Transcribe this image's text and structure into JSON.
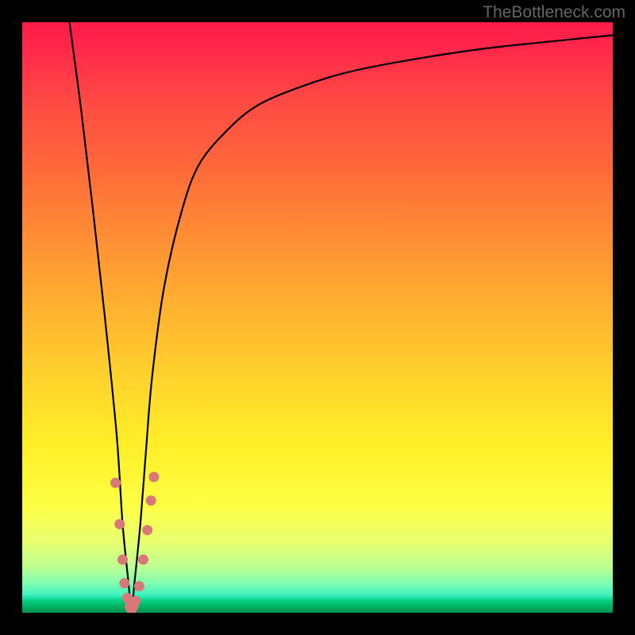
{
  "watermark": "TheBottleneck.com",
  "chart_data": {
    "type": "line",
    "title": "",
    "xlabel": "",
    "ylabel": "",
    "xlim": [
      0,
      100
    ],
    "ylim": [
      0,
      100
    ],
    "series": [
      {
        "name": "bottleneck-curve",
        "x": [
          8,
          10,
          12,
          14,
          16,
          17,
          18,
          18.5,
          19,
          20,
          21,
          22,
          24,
          27,
          30,
          35,
          40,
          47,
          55,
          65,
          78,
          92,
          100
        ],
        "y": [
          100,
          85,
          68,
          50,
          30,
          15,
          5,
          0,
          5,
          15,
          28,
          40,
          55,
          68,
          76,
          82,
          86,
          89,
          91.5,
          93.5,
          95.5,
          97,
          97.8
        ]
      }
    ],
    "scatter_points": {
      "name": "data-markers",
      "color": "#d97878",
      "points": [
        {
          "x": 15.8,
          "y": 22
        },
        {
          "x": 16.5,
          "y": 15
        },
        {
          "x": 17.0,
          "y": 9
        },
        {
          "x": 17.3,
          "y": 5
        },
        {
          "x": 17.8,
          "y": 2.5
        },
        {
          "x": 18.2,
          "y": 1
        },
        {
          "x": 18.5,
          "y": 0.5
        },
        {
          "x": 18.8,
          "y": 1
        },
        {
          "x": 19.2,
          "y": 2
        },
        {
          "x": 19.8,
          "y": 4.5
        },
        {
          "x": 20.5,
          "y": 9
        },
        {
          "x": 21.2,
          "y": 14
        },
        {
          "x": 21.8,
          "y": 19
        },
        {
          "x": 22.3,
          "y": 23
        }
      ]
    },
    "gradient_background": {
      "type": "vertical",
      "stops": [
        {
          "pos": 0,
          "color": "#ff1a4a"
        },
        {
          "pos": 50,
          "color": "#ffc030"
        },
        {
          "pos": 80,
          "color": "#ffff40"
        },
        {
          "pos": 100,
          "color": "#00a050"
        }
      ]
    }
  }
}
